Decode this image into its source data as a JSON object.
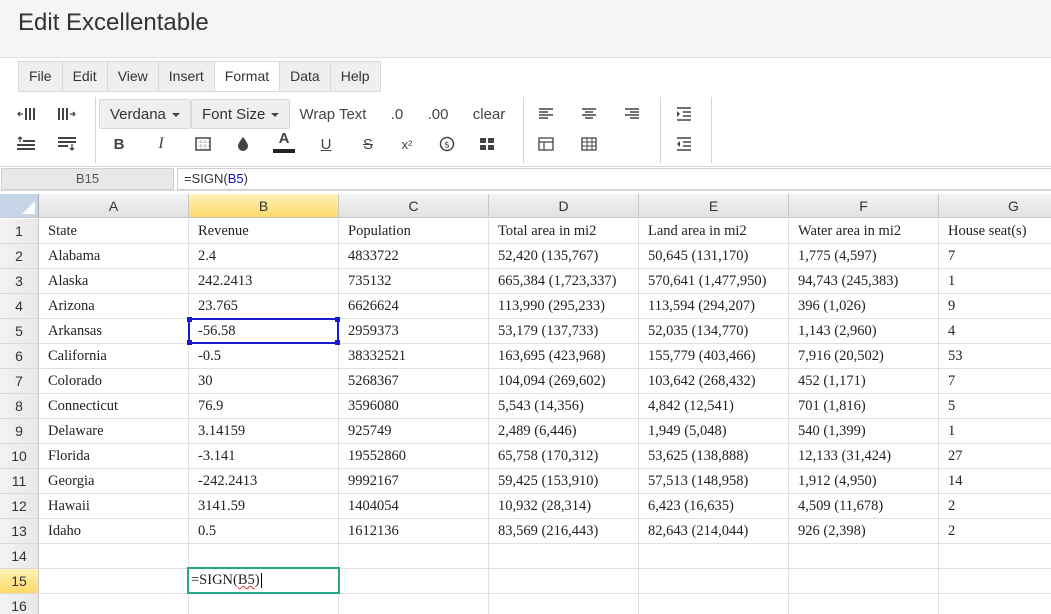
{
  "title": "Edit Excellentable",
  "menu": [
    "File",
    "Edit",
    "View",
    "Insert",
    "Format",
    "Data",
    "Help"
  ],
  "active_menu": "Format",
  "toolbar": {
    "font_family": "Verdana",
    "font_size": "Font Size",
    "wrap_text": "Wrap Text",
    "decrease_decimal": ".0",
    "increase_decimal": ".00",
    "clear": "clear",
    "bold": "B",
    "italic": "I",
    "underline": "U",
    "strikethrough": "S",
    "superscript": "x²",
    "font_color": "A"
  },
  "formula_bar": {
    "cell_ref": "B15",
    "formula_prefix": "=SIGN(",
    "formula_ref": "B5",
    "formula_suffix": ")"
  },
  "columns": [
    "A",
    "B",
    "C",
    "D",
    "E",
    "F",
    "G"
  ],
  "rows": [
    {
      "num": "1",
      "cells": [
        "State",
        "Revenue",
        "Population",
        "Total area in mi2",
        "Land area in mi2",
        "Water area in mi2",
        "House seat(s)"
      ]
    },
    {
      "num": "2",
      "cells": [
        "Alabama",
        "2.4",
        "4833722",
        "52,420 (135,767)",
        "50,645 (131,170)",
        "1,775 (4,597)",
        "7"
      ]
    },
    {
      "num": "3",
      "cells": [
        "Alaska",
        "242.2413",
        "735132",
        "665,384 (1,723,337)",
        "570,641 (1,477,950)",
        "94,743 (245,383)",
        "1"
      ]
    },
    {
      "num": "4",
      "cells": [
        "Arizona",
        "23.765",
        "6626624",
        "113,990 (295,233)",
        "113,594 (294,207)",
        "396 (1,026)",
        "9"
      ]
    },
    {
      "num": "5",
      "cells": [
        "Arkansas",
        "-56.58",
        "2959373",
        "53,179 (137,733)",
        "52,035 (134,770)",
        "1,143 (2,960)",
        "4"
      ]
    },
    {
      "num": "6",
      "cells": [
        "California",
        "-0.5",
        "38332521",
        "163,695 (423,968)",
        "155,779 (403,466)",
        "7,916 (20,502)",
        "53"
      ]
    },
    {
      "num": "7",
      "cells": [
        "Colorado",
        "30",
        "5268367",
        "104,094 (269,602)",
        "103,642 (268,432)",
        "452 (1,171)",
        "7"
      ]
    },
    {
      "num": "8",
      "cells": [
        "Connecticut",
        "76.9",
        "3596080",
        "5,543 (14,356)",
        "4,842 (12,541)",
        "701 (1,816)",
        "5"
      ]
    },
    {
      "num": "9",
      "cells": [
        "Delaware",
        "3.14159",
        "925749",
        "2,489 (6,446)",
        "1,949 (5,048)",
        "540 (1,399)",
        "1"
      ]
    },
    {
      "num": "10",
      "cells": [
        "Florida",
        "-3.141",
        "19552860",
        "65,758 (170,312)",
        "53,625 (138,888)",
        "12,133 (31,424)",
        "27"
      ]
    },
    {
      "num": "11",
      "cells": [
        "Georgia",
        "-242.2413",
        "9992167",
        "59,425 (153,910)",
        "57,513 (148,958)",
        "1,912 (4,950)",
        "14"
      ]
    },
    {
      "num": "12",
      "cells": [
        "Hawaii",
        "3141.59",
        "1404054",
        "10,932 (28,314)",
        "6,423 (16,635)",
        "4,509 (11,678)",
        "2"
      ]
    },
    {
      "num": "13",
      "cells": [
        "Idaho",
        "0.5",
        "1612136",
        "83,569 (216,443)",
        "82,643 (214,044)",
        "926 (2,398)",
        "2"
      ]
    },
    {
      "num": "14",
      "cells": [
        "",
        "",
        "",
        "",
        "",
        "",
        ""
      ]
    },
    {
      "num": "15",
      "cells": [
        "",
        "",
        "",
        "",
        "",
        "",
        ""
      ]
    },
    {
      "num": "16",
      "cells": [
        "",
        "",
        "",
        "",
        "",
        "",
        ""
      ]
    }
  ],
  "editing": {
    "cell": "B15",
    "prefix": "=SIGN(",
    "ref": "B5",
    "suffix": ")"
  },
  "selected_column": "B",
  "selected_row": "15",
  "colors": {
    "selection": "#1a1acc",
    "edit_border": "#2aa58a",
    "header_highlight": "#ffd86a"
  }
}
